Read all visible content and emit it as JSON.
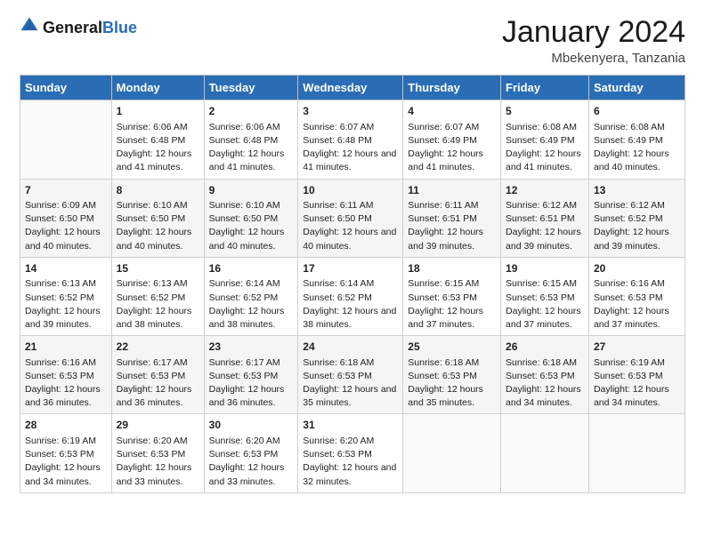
{
  "header": {
    "logo_general": "General",
    "logo_blue": "Blue",
    "title": "January 2024",
    "subtitle": "Mbekenyera, Tanzania"
  },
  "days_of_week": [
    "Sunday",
    "Monday",
    "Tuesday",
    "Wednesday",
    "Thursday",
    "Friday",
    "Saturday"
  ],
  "weeks": [
    [
      {
        "day": "",
        "sunrise": "",
        "sunset": "",
        "daylight": ""
      },
      {
        "day": "1",
        "sunrise": "Sunrise: 6:06 AM",
        "sunset": "Sunset: 6:48 PM",
        "daylight": "Daylight: 12 hours and 41 minutes."
      },
      {
        "day": "2",
        "sunrise": "Sunrise: 6:06 AM",
        "sunset": "Sunset: 6:48 PM",
        "daylight": "Daylight: 12 hours and 41 minutes."
      },
      {
        "day": "3",
        "sunrise": "Sunrise: 6:07 AM",
        "sunset": "Sunset: 6:48 PM",
        "daylight": "Daylight: 12 hours and 41 minutes."
      },
      {
        "day": "4",
        "sunrise": "Sunrise: 6:07 AM",
        "sunset": "Sunset: 6:49 PM",
        "daylight": "Daylight: 12 hours and 41 minutes."
      },
      {
        "day": "5",
        "sunrise": "Sunrise: 6:08 AM",
        "sunset": "Sunset: 6:49 PM",
        "daylight": "Daylight: 12 hours and 41 minutes."
      },
      {
        "day": "6",
        "sunrise": "Sunrise: 6:08 AM",
        "sunset": "Sunset: 6:49 PM",
        "daylight": "Daylight: 12 hours and 40 minutes."
      }
    ],
    [
      {
        "day": "7",
        "sunrise": "Sunrise: 6:09 AM",
        "sunset": "Sunset: 6:50 PM",
        "daylight": "Daylight: 12 hours and 40 minutes."
      },
      {
        "day": "8",
        "sunrise": "Sunrise: 6:10 AM",
        "sunset": "Sunset: 6:50 PM",
        "daylight": "Daylight: 12 hours and 40 minutes."
      },
      {
        "day": "9",
        "sunrise": "Sunrise: 6:10 AM",
        "sunset": "Sunset: 6:50 PM",
        "daylight": "Daylight: 12 hours and 40 minutes."
      },
      {
        "day": "10",
        "sunrise": "Sunrise: 6:11 AM",
        "sunset": "Sunset: 6:50 PM",
        "daylight": "Daylight: 12 hours and 40 minutes."
      },
      {
        "day": "11",
        "sunrise": "Sunrise: 6:11 AM",
        "sunset": "Sunset: 6:51 PM",
        "daylight": "Daylight: 12 hours and 39 minutes."
      },
      {
        "day": "12",
        "sunrise": "Sunrise: 6:12 AM",
        "sunset": "Sunset: 6:51 PM",
        "daylight": "Daylight: 12 hours and 39 minutes."
      },
      {
        "day": "13",
        "sunrise": "Sunrise: 6:12 AM",
        "sunset": "Sunset: 6:52 PM",
        "daylight": "Daylight: 12 hours and 39 minutes."
      }
    ],
    [
      {
        "day": "14",
        "sunrise": "Sunrise: 6:13 AM",
        "sunset": "Sunset: 6:52 PM",
        "daylight": "Daylight: 12 hours and 39 minutes."
      },
      {
        "day": "15",
        "sunrise": "Sunrise: 6:13 AM",
        "sunset": "Sunset: 6:52 PM",
        "daylight": "Daylight: 12 hours and 38 minutes."
      },
      {
        "day": "16",
        "sunrise": "Sunrise: 6:14 AM",
        "sunset": "Sunset: 6:52 PM",
        "daylight": "Daylight: 12 hours and 38 minutes."
      },
      {
        "day": "17",
        "sunrise": "Sunrise: 6:14 AM",
        "sunset": "Sunset: 6:52 PM",
        "daylight": "Daylight: 12 hours and 38 minutes."
      },
      {
        "day": "18",
        "sunrise": "Sunrise: 6:15 AM",
        "sunset": "Sunset: 6:53 PM",
        "daylight": "Daylight: 12 hours and 37 minutes."
      },
      {
        "day": "19",
        "sunrise": "Sunrise: 6:15 AM",
        "sunset": "Sunset: 6:53 PM",
        "daylight": "Daylight: 12 hours and 37 minutes."
      },
      {
        "day": "20",
        "sunrise": "Sunrise: 6:16 AM",
        "sunset": "Sunset: 6:53 PM",
        "daylight": "Daylight: 12 hours and 37 minutes."
      }
    ],
    [
      {
        "day": "21",
        "sunrise": "Sunrise: 6:16 AM",
        "sunset": "Sunset: 6:53 PM",
        "daylight": "Daylight: 12 hours and 36 minutes."
      },
      {
        "day": "22",
        "sunrise": "Sunrise: 6:17 AM",
        "sunset": "Sunset: 6:53 PM",
        "daylight": "Daylight: 12 hours and 36 minutes."
      },
      {
        "day": "23",
        "sunrise": "Sunrise: 6:17 AM",
        "sunset": "Sunset: 6:53 PM",
        "daylight": "Daylight: 12 hours and 36 minutes."
      },
      {
        "day": "24",
        "sunrise": "Sunrise: 6:18 AM",
        "sunset": "Sunset: 6:53 PM",
        "daylight": "Daylight: 12 hours and 35 minutes."
      },
      {
        "day": "25",
        "sunrise": "Sunrise: 6:18 AM",
        "sunset": "Sunset: 6:53 PM",
        "daylight": "Daylight: 12 hours and 35 minutes."
      },
      {
        "day": "26",
        "sunrise": "Sunrise: 6:18 AM",
        "sunset": "Sunset: 6:53 PM",
        "daylight": "Daylight: 12 hours and 34 minutes."
      },
      {
        "day": "27",
        "sunrise": "Sunrise: 6:19 AM",
        "sunset": "Sunset: 6:53 PM",
        "daylight": "Daylight: 12 hours and 34 minutes."
      }
    ],
    [
      {
        "day": "28",
        "sunrise": "Sunrise: 6:19 AM",
        "sunset": "Sunset: 6:53 PM",
        "daylight": "Daylight: 12 hours and 34 minutes."
      },
      {
        "day": "29",
        "sunrise": "Sunrise: 6:20 AM",
        "sunset": "Sunset: 6:53 PM",
        "daylight": "Daylight: 12 hours and 33 minutes."
      },
      {
        "day": "30",
        "sunrise": "Sunrise: 6:20 AM",
        "sunset": "Sunset: 6:53 PM",
        "daylight": "Daylight: 12 hours and 33 minutes."
      },
      {
        "day": "31",
        "sunrise": "Sunrise: 6:20 AM",
        "sunset": "Sunset: 6:53 PM",
        "daylight": "Daylight: 12 hours and 32 minutes."
      },
      {
        "day": "",
        "sunrise": "",
        "sunset": "",
        "daylight": ""
      },
      {
        "day": "",
        "sunrise": "",
        "sunset": "",
        "daylight": ""
      },
      {
        "day": "",
        "sunrise": "",
        "sunset": "",
        "daylight": ""
      }
    ]
  ]
}
